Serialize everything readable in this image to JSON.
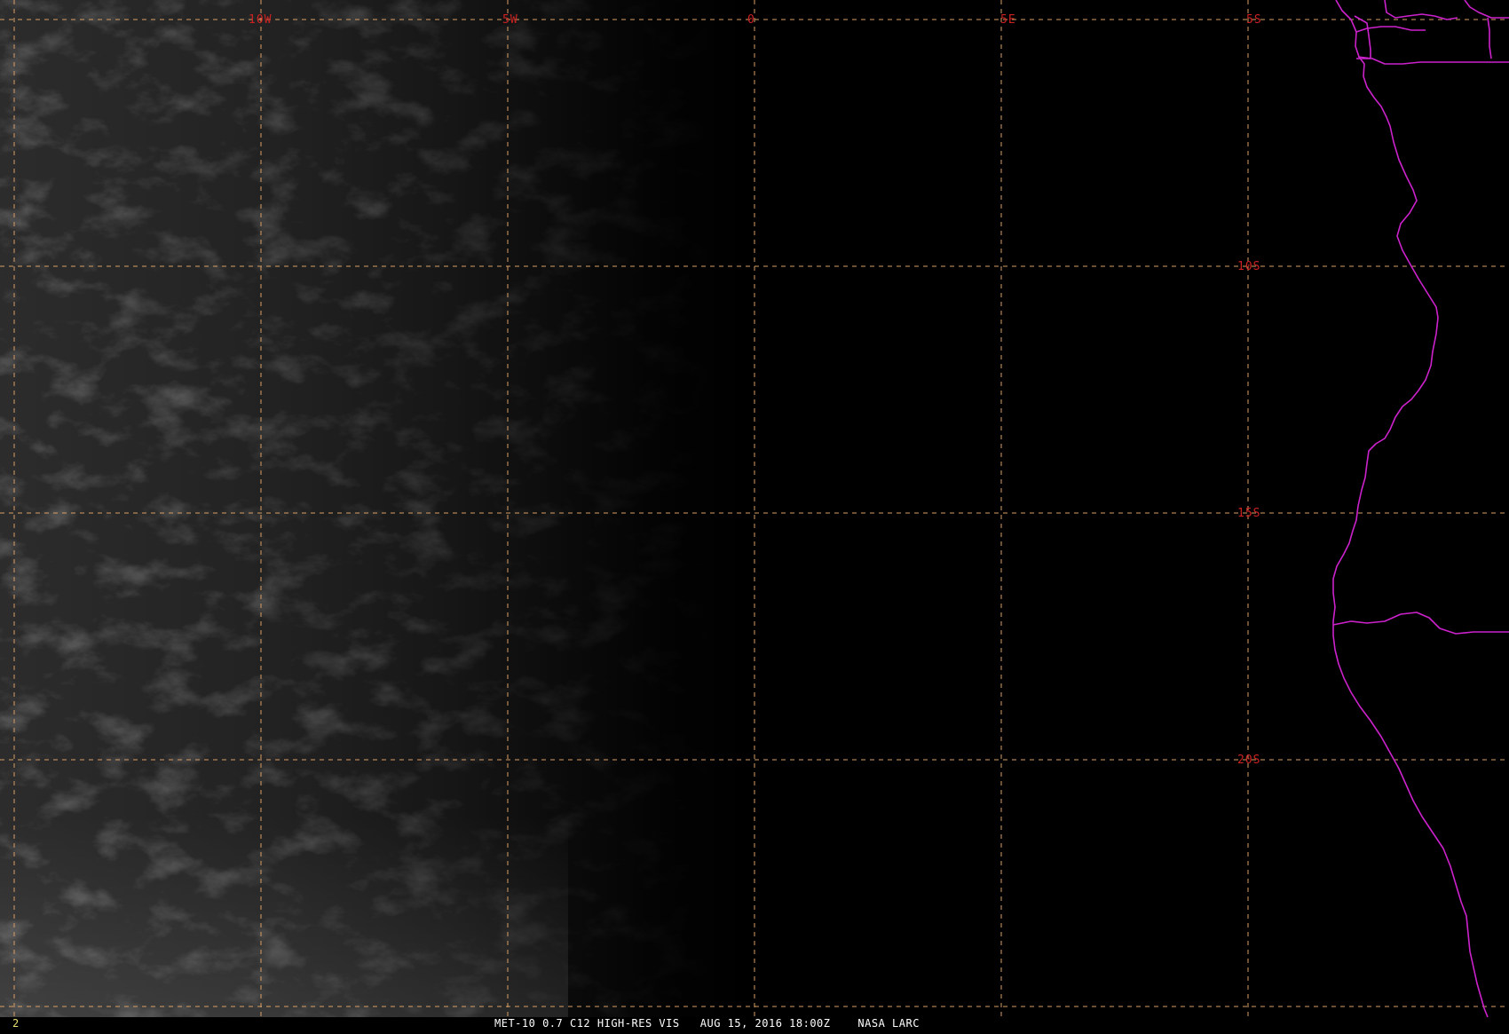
{
  "image": {
    "description": "Satellite visible imagery over South Atlantic with lat/lon grid and African coastline",
    "colors": {
      "grid": "#d9a066",
      "grid_label": "#cc2222",
      "coastline": "#cc22cc",
      "background": "#000000",
      "frame_number": "#e8e070",
      "caption": "#ffffff"
    }
  },
  "grid": {
    "longitude_labels": [
      "10W",
      "5W",
      "0",
      "5E"
    ],
    "latitude_labels": [
      "5S",
      "10S",
      "15S",
      "20S"
    ]
  },
  "status": {
    "frame_number": "2",
    "caption": "MET-10 0.7 C12 HIGH-RES VIS   AUG 15, 2016 18:00Z    NASA LARC"
  }
}
